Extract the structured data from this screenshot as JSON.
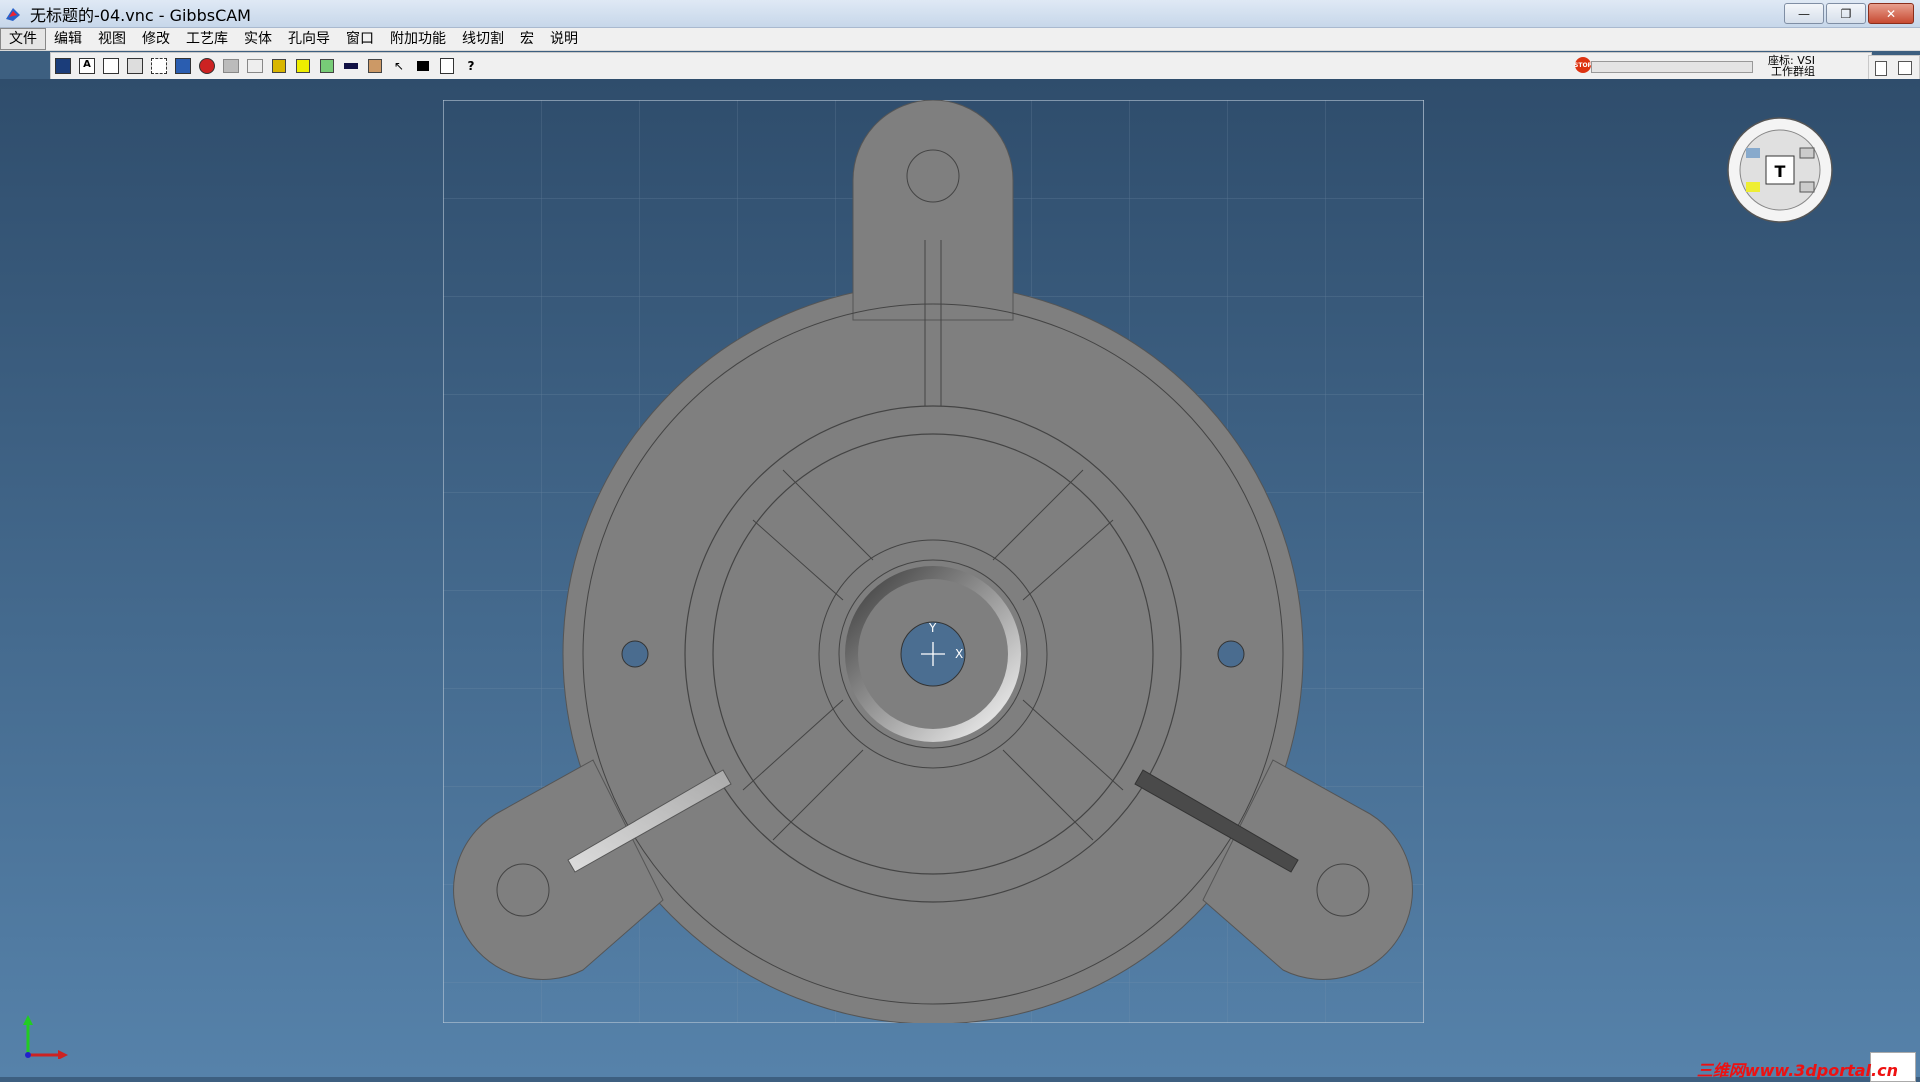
{
  "window": {
    "title": "无标题的-04.vnc - GibbsCAM",
    "buttons": [
      "—",
      "❐",
      "✕"
    ]
  },
  "menu": {
    "items": [
      "文件",
      "编辑",
      "视图",
      "修改",
      "工艺库",
      "实体",
      "孔向导",
      "窗口",
      "附加功能",
      "线切割",
      "宏",
      "说明"
    ]
  },
  "toolbar": {
    "stop_label": "STOP",
    "coord_label": "座标: VSI",
    "coord_sub": "工作群组"
  },
  "viewport": {
    "axis_y": "Y",
    "axis_x": "X",
    "dial_label": "T"
  },
  "watermark": "三维网www.3dportal.cn"
}
